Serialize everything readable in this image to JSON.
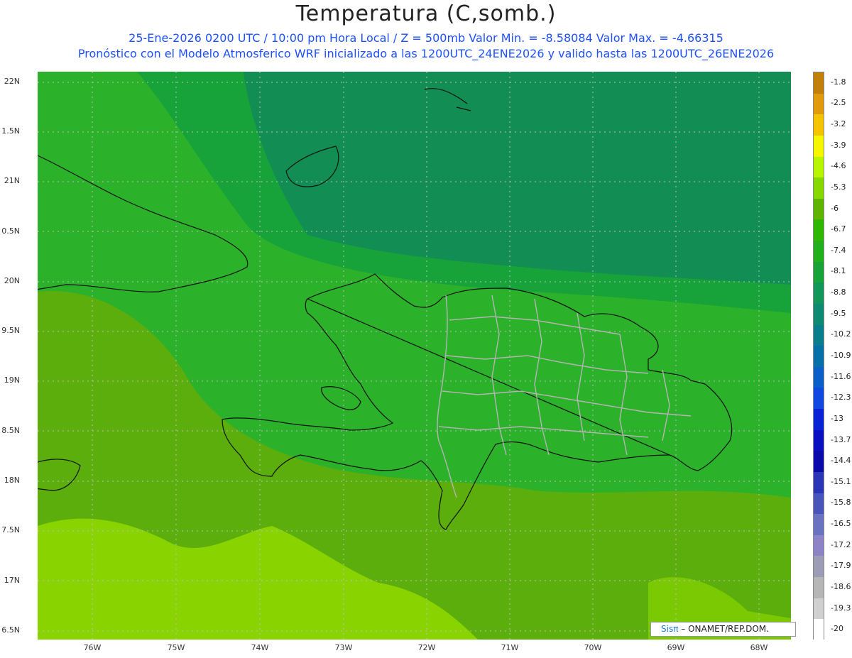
{
  "title": "Temperatura (C,somb.)",
  "subtitle_line1": "25-Ene-2026  0200 UTC / 10:00 pm Hora Local / Z = 500mb  Valor Min. = -8.58084  Valor Max. = -4.66315",
  "subtitle_line2": "Pronóstico con el Modelo Atmosferico WRF inicializado a las 1200UTC_24ENE2026 y valido hasta las  1200UTC_26ENE2026",
  "lat_labels": [
    "22N",
    "1.5N",
    "21N",
    "0.5N",
    "20N",
    "9.5N",
    "19N",
    "8.5N",
    "18N",
    "7.5N",
    "17N",
    "6.5N"
  ],
  "lon_labels": [
    "76W",
    "75W",
    "74W",
    "73W",
    "72W",
    "71W",
    "70W",
    "69W",
    "68W"
  ],
  "colorbar": {
    "labels": [
      "-1.8",
      "-2.5",
      "-3.2",
      "-3.9",
      "-4.6",
      "-5.3",
      "-6",
      "-6.7",
      "-7.4",
      "-8.1",
      "-8.8",
      "-9.5",
      "-10.2",
      "-10.9",
      "-11.6",
      "-12.3",
      "-13",
      "-13.7",
      "-14.4",
      "-15.1",
      "-15.8",
      "-16.5",
      "-17.2",
      "-17.9",
      "-18.6",
      "-19.3",
      "-20"
    ],
    "colors": [
      "#c27f0a",
      "#e09a0b",
      "#f5c400",
      "#f6f600",
      "#b9f500",
      "#86d800",
      "#5fb400",
      "#2fb800",
      "#21b01c",
      "#17a338",
      "#12965a",
      "#0e8a72",
      "#0a7e8a",
      "#0870a8",
      "#0a60c8",
      "#1048e0",
      "#0a22d6",
      "#0a10c2",
      "#0a0aaa",
      "#2a36b6",
      "#4a55bc",
      "#6b72c2",
      "#8c84c6",
      "#9c9cb6",
      "#b6b6b6",
      "#d0d0d0",
      "#ffffff"
    ]
  },
  "credit": {
    "brand": "Sisπ",
    "text": "– ONAMET/REP.DOM."
  }
}
